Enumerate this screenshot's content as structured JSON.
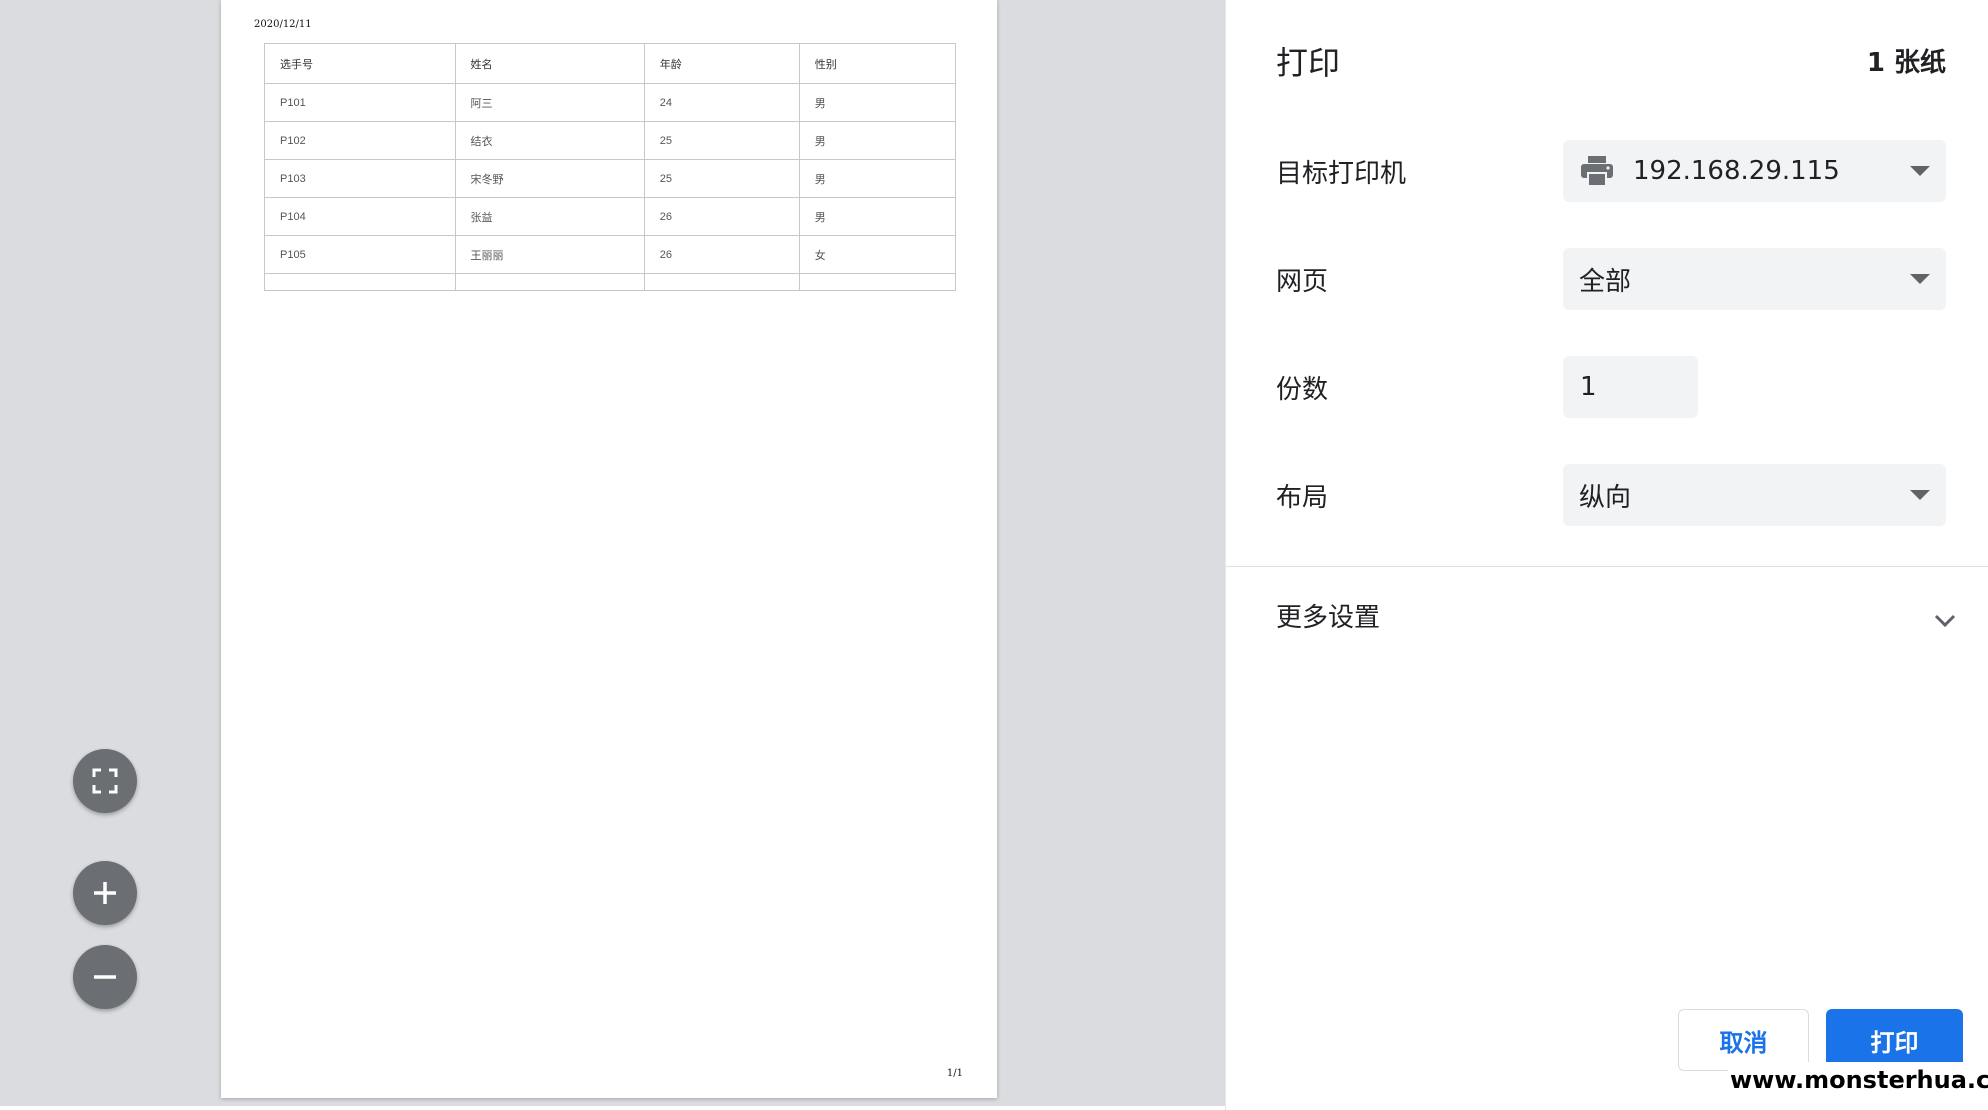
{
  "preview": {
    "date": "2020/12/11",
    "table": {
      "headers": [
        "选手号",
        "姓名",
        "年龄",
        "性别"
      ],
      "rows": [
        [
          "P101",
          "阿三",
          "24",
          "男"
        ],
        [
          "P102",
          "结衣",
          "25",
          "男"
        ],
        [
          "P103",
          "宋冬野",
          "25",
          "男"
        ],
        [
          "P104",
          "张益",
          "26",
          "男"
        ],
        [
          "P105",
          "王丽丽",
          "26",
          "女"
        ]
      ]
    },
    "page_number": "1/1"
  },
  "zoom_controls": {
    "fit_icon": "fit-to-page-icon",
    "zoom_in_icon": "plus-icon",
    "zoom_out_icon": "minus-icon"
  },
  "panel": {
    "title": "打印",
    "sheet_count": "1 张纸",
    "destination": {
      "label": "目标打印机",
      "value": "192.168.29.115",
      "icon": "printer-icon"
    },
    "pages": {
      "label": "网页",
      "value": "全部"
    },
    "copies": {
      "label": "份数",
      "value": "1"
    },
    "layout": {
      "label": "布局",
      "value": "纵向"
    },
    "more_settings": {
      "label": "更多设置",
      "icon": "chevron-down-icon"
    },
    "cancel_label": "取消",
    "print_label": "打印"
  },
  "watermark": "www.monsterhua.com",
  "colors": {
    "accent": "#1a73e8",
    "preview_bg": "#dadce0",
    "field_bg": "#f1f3f4"
  }
}
